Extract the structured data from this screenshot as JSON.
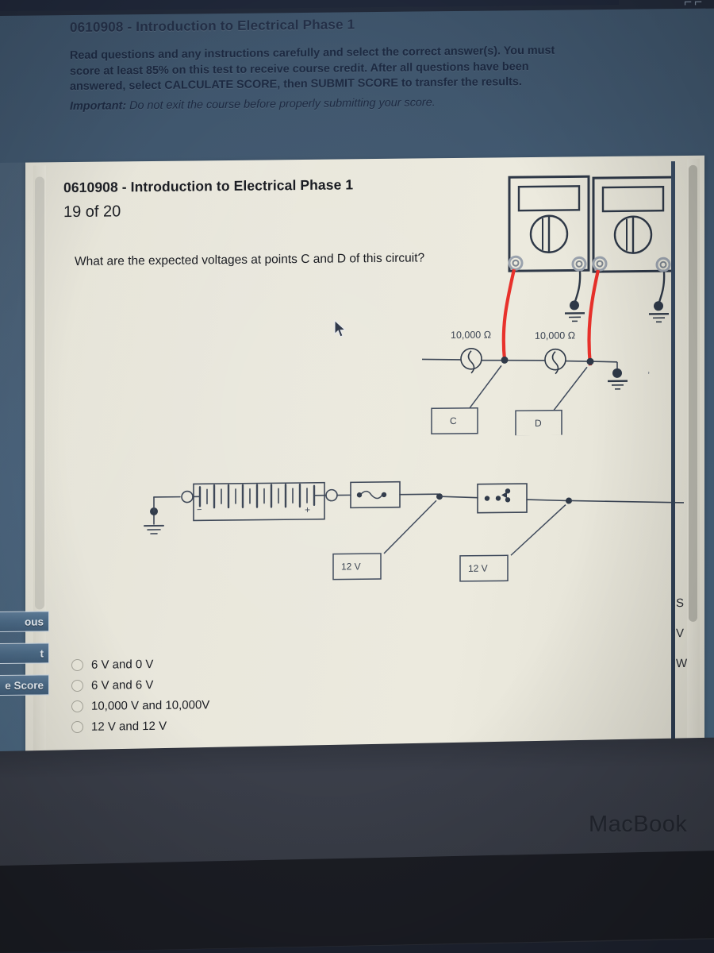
{
  "header": {
    "course_title": "0610908 - Introduction to Electrical Phase 1",
    "instructions_line1": "Read questions and any instructions carefully and select the correct answer(s).  You must",
    "instructions_line2": "score at least 85% on this test to receive course credit.  After all questions have been",
    "instructions_line3a": "answered, select ",
    "instructions_calc": "CALCULATE SCORE",
    "instructions_line3b": ", then ",
    "instructions_submit": "SUBMIT SCORE",
    "instructions_line3c": " to transfer the results.",
    "important_label": "Important:",
    "important_text": "  Do not exit the course before properly submitting your score.",
    "top_right_glyph": "⌐⌐"
  },
  "question": {
    "title": "0610908 - Introduction to Electrical Phase 1",
    "counter": "19  of 20",
    "prompt": "What are the expected voltages at points C and D of this circuit?"
  },
  "options": [
    {
      "label": "6 V and 0 V",
      "selected": false
    },
    {
      "label": "6 V and 6 V",
      "selected": false
    },
    {
      "label": "10,000 V and 10,000V",
      "selected": false
    },
    {
      "label": "12 V and 12 V",
      "selected": false
    }
  ],
  "nav_buttons": [
    {
      "label": "Previous",
      "visible_text": "ous"
    },
    {
      "label": "Next",
      "visible_text": "t"
    },
    {
      "label": "Calculate Score",
      "visible_text": "e Score"
    }
  ],
  "right_column_fragments": [
    "S",
    "V",
    "W"
  ],
  "laptop": {
    "brand": "MacBook"
  },
  "circuit": {
    "resistor_1_label": "10,000 Ω",
    "resistor_2_label": "10,000 Ω",
    "callouts": [
      {
        "id": "callout-a",
        "label": "12 V"
      },
      {
        "id": "callout-b",
        "label": "12 V"
      },
      {
        "id": "callout-c",
        "label": "C"
      },
      {
        "id": "callout-d",
        "label": "D"
      }
    ],
    "meter_lead_color": "#e8302a",
    "wire_color": "#3a4454",
    "battery_terminal_minus": "-",
    "battery_terminal_plus": "+"
  }
}
